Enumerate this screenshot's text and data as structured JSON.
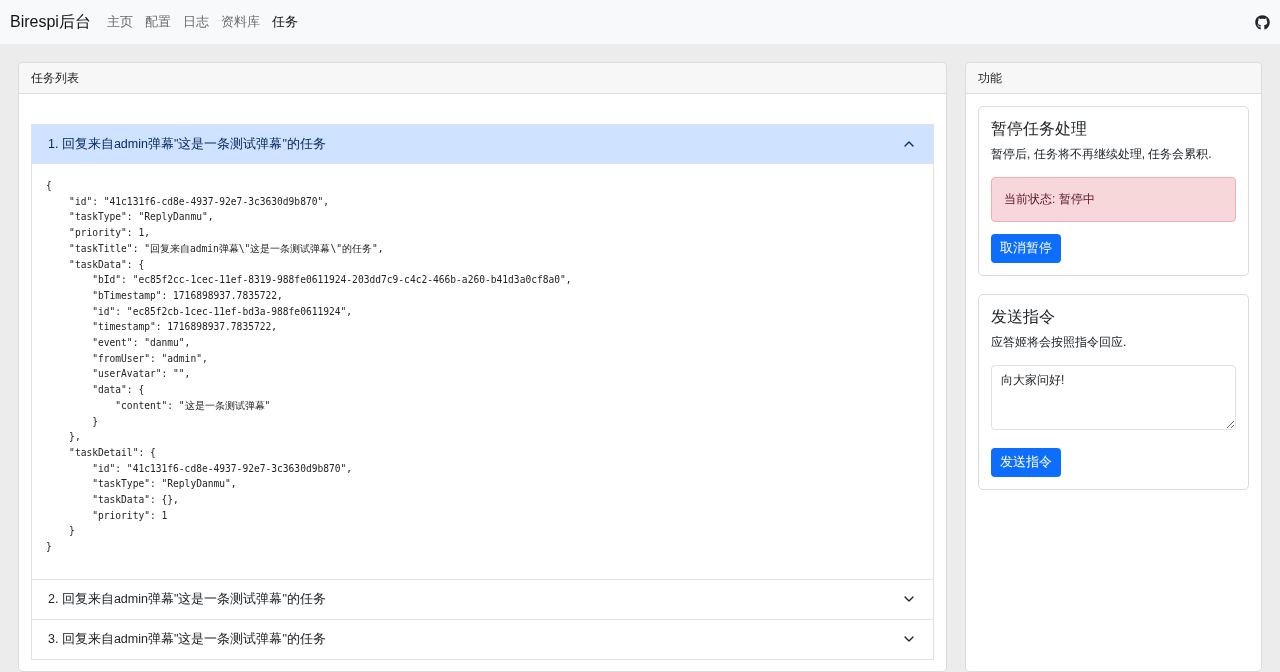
{
  "navbar": {
    "brand": "Birespi后台",
    "links": [
      {
        "label": "主页",
        "selected": false
      },
      {
        "label": "配置",
        "selected": false
      },
      {
        "label": "日志",
        "selected": false
      },
      {
        "label": "资料库",
        "selected": false
      },
      {
        "label": "任务",
        "selected": true
      }
    ]
  },
  "task_panel": {
    "title": "任务列表",
    "tasks": [
      {
        "title": "1. 回复来自admin弹幕\"这是一条测试弹幕\"的任务",
        "expanded": true,
        "body": "{\n    \"id\": \"41c131f6-cd8e-4937-92e7-3c3630d9b870\",\n    \"taskType\": \"ReplyDanmu\",\n    \"priority\": 1,\n    \"taskTitle\": \"回复来自admin弹幕\\\"这是一条测试弹幕\\\"的任务\",\n    \"taskData\": {\n        \"bId\": \"ec85f2cc-1cec-11ef-8319-988fe0611924-203dd7c9-c4c2-466b-a260-b41d3a0cf8a0\",\n        \"bTimestamp\": 1716898937.7835722,\n        \"id\": \"ec85f2cb-1cec-11ef-bd3a-988fe0611924\",\n        \"timestamp\": 1716898937.7835722,\n        \"event\": \"danmu\",\n        \"fromUser\": \"admin\",\n        \"userAvatar\": \"\",\n        \"data\": {\n            \"content\": \"这是一条测试弹幕\"\n        }\n    },\n    \"taskDetail\": {\n        \"id\": \"41c131f6-cd8e-4937-92e7-3c3630d9b870\",\n        \"taskType\": \"ReplyDanmu\",\n        \"taskData\": {},\n        \"priority\": 1\n    }\n}"
      },
      {
        "title": "2. 回复来自admin弹幕\"这是一条测试弹幕\"的任务",
        "expanded": false
      },
      {
        "title": "3. 回复来自admin弹幕\"这是一条测试弹幕\"的任务",
        "expanded": false
      }
    ]
  },
  "function_panel": {
    "title": "功能",
    "pause_card": {
      "heading": "暂停任务处理",
      "description": "暂停后, 任务将不再继续处理, 任务会累积.",
      "status": "当前状态: 暂停中",
      "button": "取消暂停"
    },
    "command_card": {
      "heading": "发送指令",
      "description": "应答姬将会按照指令回应.",
      "value": "向大家问好!",
      "button": "发送指令"
    }
  }
}
